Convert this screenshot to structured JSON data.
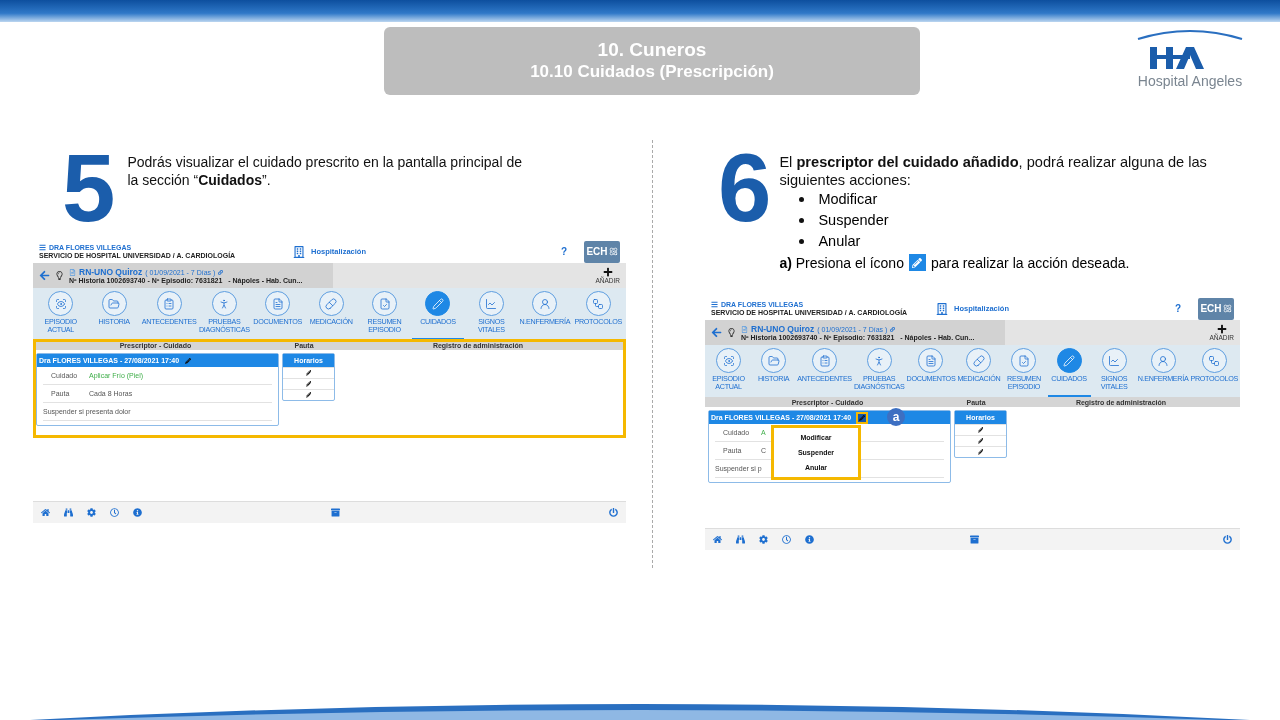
{
  "header": {
    "title": "10. Cuneros",
    "subtitle": "10.10 Cuidados (Prescripción)"
  },
  "logo": {
    "text": "Hospital Angeles"
  },
  "steps": [
    {
      "number": "5",
      "text": "Podrás visualizar el cuidado prescrito en la pantalla principal de la sección “**Cuidados**”.",
      "screen": {
        "user": "DRA FLORES VILLEGAS",
        "service": "SERVICIO DE HOSPITAL UNIVERSIDAD / A. CARDIOLOGÍA",
        "module": "Hospitalización",
        "help": "?",
        "brand": "ECH",
        "patient": "RN-UNO Quiroz",
        "dates": "( 01/09/2021 - 7 Días )",
        "details": "Nº Historia 1002693740 - Nº Episodio: 7631821   - Nápoles - Hab. Cun...",
        "add_label": "AÑADIR",
        "nav": [
          {
            "label": "EPISODIO ACTUAL",
            "selected": false
          },
          {
            "label": "HISTORIA",
            "selected": false
          },
          {
            "label": "ANTECEDENTES",
            "selected": false
          },
          {
            "label": "PRUEBAS DIAGNÓSTICAS",
            "selected": false
          },
          {
            "label": "DOCUMENTOS",
            "selected": false
          },
          {
            "label": "MEDICACIÓN",
            "selected": false
          },
          {
            "label": "RESUMEN EPISODIO",
            "selected": false
          },
          {
            "label": "CUIDADOS",
            "selected": true
          },
          {
            "label": "SIGNOS VITALES",
            "selected": false
          },
          {
            "label": "N.ENFERMERÍA",
            "selected": false
          },
          {
            "label": "PROTOCOLOS",
            "selected": false
          }
        ],
        "columns": [
          "Prescriptor - Cuidado",
          "Pauta",
          "Registro de administración"
        ],
        "table_highlighted": true,
        "care": {
          "header": "Dra FLORES VILLEGAS - 27/08/2021 17:40",
          "rows": [
            {
              "kind": "care",
              "label": "Cuidado",
              "value": "Aplicar Frío (Piel)"
            },
            {
              "kind": "schedule",
              "label": "Pauta",
              "value": "Cada 8 Horas"
            },
            {
              "kind": "note",
              "value": "Suspender si presenta dolor"
            }
          ]
        },
        "schedule": {
          "header": "Horarios",
          "entries": [
            {
              "kind": "edit"
            },
            {
              "kind": "edit"
            },
            {
              "kind": "edit"
            }
          ]
        }
      }
    },
    {
      "number": "6",
      "intro": "El **prescriptor del cuidado añadido**, podrá realizar alguna de las siguientes acciones:",
      "bullets": [
        "Modificar",
        "Suspender",
        "Anular"
      ],
      "note_before": "**a)** Presiona el ícono",
      "note_after": "para realizar la acción deseada.",
      "screen": {
        "user": "DRA FLORES VILLEGAS",
        "service": "SERVICIO DE HOSPITAL UNIVERSIDAD / A. CARDIOLOGÍA",
        "module": "Hospitalización",
        "help": "?",
        "brand": "ECH",
        "patient": "RN-UNO Quiroz",
        "dates": "( 01/09/2021 - 7 Días )",
        "details": "Nº Historia 1002693740 - Nº Episodio: 7631821   - Nápoles - Hab. Cun...",
        "add_label": "AÑADIR",
        "nav": [
          {
            "label": "EPISODIO ACTUAL",
            "selected": false
          },
          {
            "label": "HISTORIA",
            "selected": false
          },
          {
            "label": "ANTECEDENTES",
            "selected": false
          },
          {
            "label": "PRUEBAS DIAGNÓSTICAS",
            "selected": false
          },
          {
            "label": "DOCUMENTOS",
            "selected": false
          },
          {
            "label": "MEDICACIÓN",
            "selected": false
          },
          {
            "label": "RESUMEN EPISODIO",
            "selected": false
          },
          {
            "label": "CUIDADOS",
            "selected": true
          },
          {
            "label": "SIGNOS VITALES",
            "selected": false
          },
          {
            "label": "N.ENFERMERÍA",
            "selected": false
          },
          {
            "label": "PROTOCOLOS",
            "selected": false
          }
        ],
        "columns": [
          "Prescriptor - Cuidado",
          "Pauta",
          "Registro de administración"
        ],
        "care": {
          "header": "Dra FLORES VILLEGAS - 27/08/2021 17:40",
          "rows": [
            {
              "kind": "care",
              "label": "Cuidado",
              "value": "A"
            },
            {
              "kind": "schedule",
              "label": "Pauta",
              "value": "C"
            },
            {
              "kind": "note",
              "value": "Suspender si p"
            }
          ]
        },
        "schedule": {
          "header": "Horarios",
          "entries": [
            {
              "kind": "edit"
            },
            {
              "kind": "edit"
            },
            {
              "kind": "edit"
            }
          ]
        },
        "menu": {
          "badge": "a",
          "items": [
            "Modificar",
            "Suspender",
            "Anular"
          ]
        }
      }
    }
  ]
}
